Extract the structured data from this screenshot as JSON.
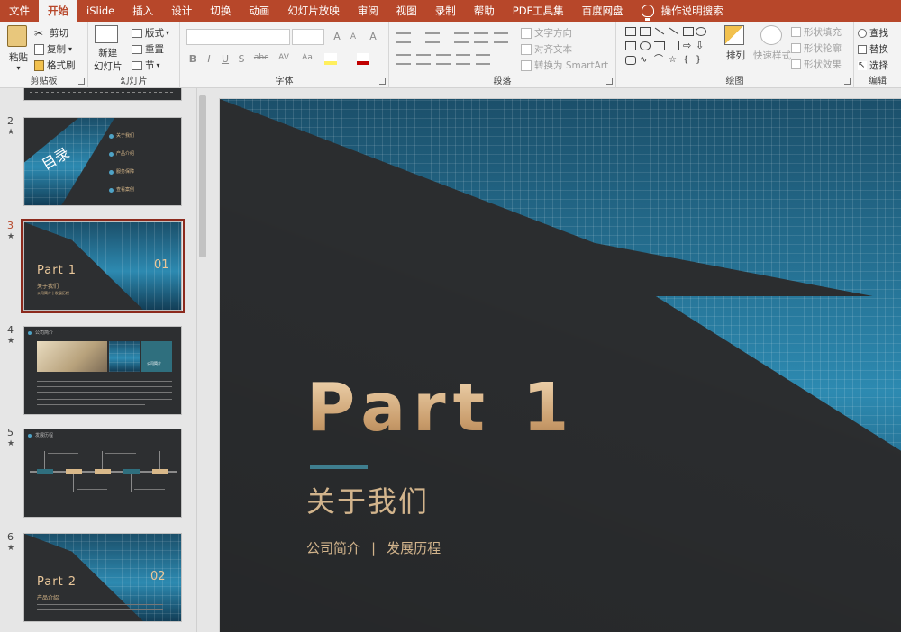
{
  "menu": {
    "tabs": [
      "文件",
      "开始",
      "iSlide",
      "插入",
      "设计",
      "切换",
      "动画",
      "幻灯片放映",
      "审阅",
      "视图",
      "录制",
      "帮助",
      "PDF工具集",
      "百度网盘"
    ],
    "active_tab": "开始",
    "tell_me": "操作说明搜索"
  },
  "ribbon": {
    "clipboard": {
      "paste": "粘贴",
      "cut": "剪切",
      "copy": "复制",
      "format_painter": "格式刷",
      "label": "剪贴板"
    },
    "slides": {
      "new_slide": "新建",
      "new_slide_2": "幻灯片",
      "layout": "版式",
      "reset": "重置",
      "section": "节",
      "label": "幻灯片"
    },
    "font": {
      "label": "字体",
      "bold": "B",
      "italic": "I",
      "underline": "U",
      "shadow": "S",
      "strike": "abc",
      "spacing": "AV",
      "case": "Aa",
      "grow": "A",
      "shrink": "A",
      "clear": "A"
    },
    "paragraph": {
      "text_direction": "文字方向",
      "align_text": "对齐文本",
      "smartart": "转换为 SmartArt",
      "label": "段落"
    },
    "drawing": {
      "arrange": "排列",
      "quick_styles": "快速样式",
      "shape_fill": "形状填充",
      "shape_outline": "形状轮廓",
      "shape_effects": "形状效果",
      "label": "绘图"
    },
    "editing": {
      "find": "查找",
      "replace": "替换",
      "select": "选择",
      "label": "编辑"
    }
  },
  "thumbnails": [
    {
      "num": "2",
      "star": "★",
      "title_vertical": "目录",
      "items": [
        "关于我们",
        "产品介绍",
        "服务保障",
        "查看案例"
      ]
    },
    {
      "num": "3",
      "star": "★",
      "selected": true,
      "title": "Part 1",
      "badge": "01",
      "subtitle": "关于我们",
      "small": "公司简介 | 发展历程"
    },
    {
      "num": "4",
      "star": "★",
      "header": "公司简介",
      "side_title": "公司简介"
    },
    {
      "num": "5",
      "star": "★",
      "header": "发展历程"
    },
    {
      "num": "6",
      "star": "★",
      "title": "Part 2",
      "badge": "02",
      "subtitle": "产品介绍"
    }
  ],
  "slide": {
    "title": "Part 1",
    "subtitle": "关于我们",
    "link_1": "公司简介",
    "separator": "|",
    "link_2": "发展历程"
  },
  "colors": {
    "accent": "#b7472a",
    "slide_bg": "#2b2d2f",
    "gold": "#d2b48c",
    "teal": "#3f7e8f"
  }
}
